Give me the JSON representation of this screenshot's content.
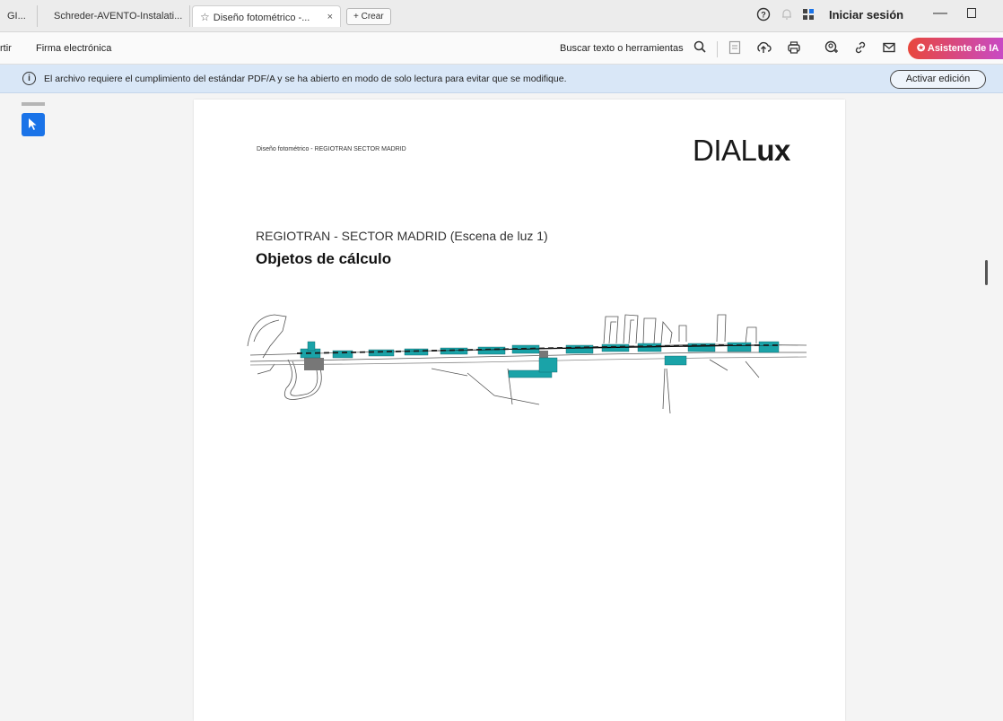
{
  "tabs": [
    {
      "label": "GI..."
    },
    {
      "label": "Schreder-AVENTO-Instalati..."
    },
    {
      "label": "Diseño fotométrico -...",
      "active": true
    }
  ],
  "new_tab_label": "+ Crear",
  "account": {
    "signin_label": "Iniciar sesión"
  },
  "toolbar": {
    "left_items": [
      "rtir",
      "Firma electrónica"
    ],
    "search_label": "Buscar texto o herramientas",
    "ai_button_label": "Asistente de IA"
  },
  "banner": {
    "message": "El archivo requiere el cumplimiento del estándar PDF/A y se ha abierto en modo de solo lectura para evitar que se modifique.",
    "button_label": "Activar edición"
  },
  "document": {
    "header_text": "Diseño fotométrico - REGIOTRAN SECTOR MADRID",
    "logo_light": "DIAL",
    "logo_bold": "ux",
    "title": "REGIOTRAN - SECTOR MADRID (Escena de luz 1)",
    "subtitle": "Objetos de cálculo"
  },
  "colors": {
    "accent": "#1a73e8",
    "banner_bg": "#d9e7f7",
    "drawing_teal": "#1aa3a8"
  }
}
